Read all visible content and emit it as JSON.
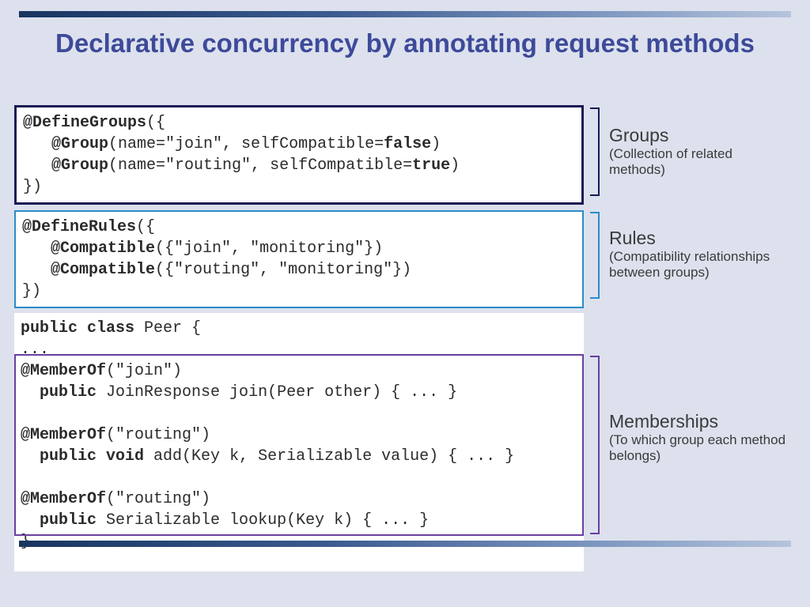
{
  "title": "Declarative concurrency by annotating request methods",
  "code": {
    "groups": "<span class='bb'>@DefineGroups</span>({\n   <span class='bb'>@Group</span>(name=\"join\", selfCompatible=<span class='bb'>false</span>)\n   <span class='bb'>@Group</span>(name=\"routing\", selfCompatible=<span class='bb'>true</span>)\n})",
    "rules": "<span class='bb'>@DefineRules</span>({\n   <span class='bb'>@Compatible</span>({\"join\", \"monitoring\"})\n   <span class='bb'>@Compatible</span>({\"routing\", \"monitoring\"})\n})",
    "classblock": "<span class='bb'>public class</span> Peer {\n...\n<span class='bb'>@MemberOf</span>(\"join\")\n  <span class='bb'>public</span> JoinResponse join(Peer other) { ... }\n\n<span class='bb'>@MemberOf</span>(\"routing\")\n  <span class='bb'>public void</span> add(Key k, Serializable value) { ... }\n\n<span class='bb'>@MemberOf</span>(\"routing\")\n  <span class='bb'>public</span> Serializable lookup(Key k) { ... }\n}"
  },
  "labels": {
    "groups": {
      "hdr": "Groups",
      "sub": "(Collection of related methods)"
    },
    "rules": {
      "hdr": "Rules",
      "sub": "(Compatibility relationships between groups)"
    },
    "members": {
      "hdr": "Memberships",
      "sub": "(To which group each method belongs)"
    }
  },
  "colors": {
    "background": "#dde1ed",
    "title": "#3d4a9a",
    "groups_border": "#1a1a55",
    "rules_border": "#2a8cc9",
    "members_border": "#6a3fa0"
  }
}
